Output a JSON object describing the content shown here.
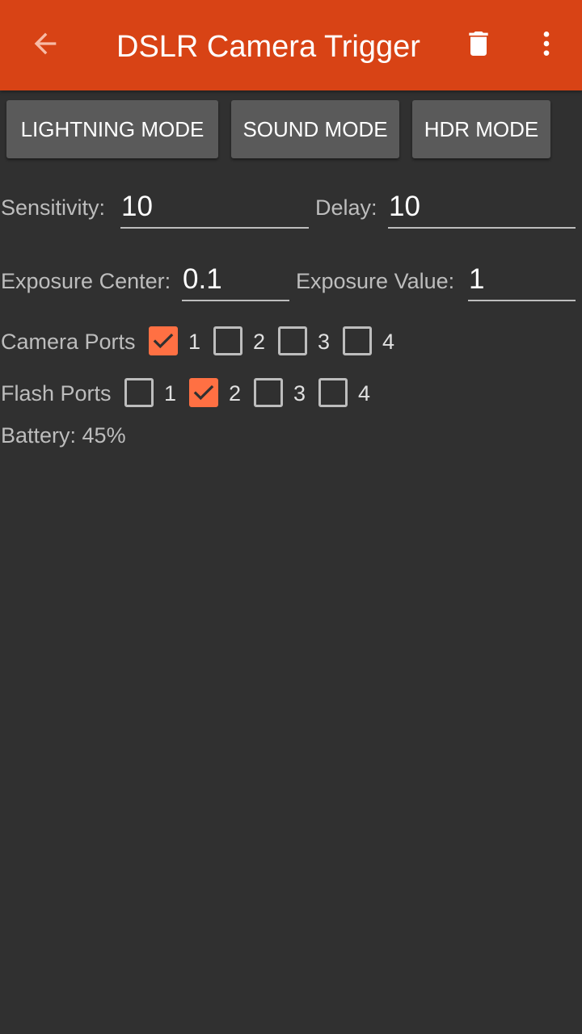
{
  "appbar": {
    "title": "DSLR Camera Trigger",
    "back_icon": "arrow-back-icon",
    "delete_icon": "trash-icon",
    "menu_icon": "more-vert-icon",
    "color": "#d84315"
  },
  "modes": {
    "lightning_label": "LIGHTNING MODE",
    "sound_label": "SOUND MODE",
    "hdr_label": "HDR MODE"
  },
  "fields": {
    "sensitivity": {
      "label": "Sensitivity:",
      "value": "10"
    },
    "delay": {
      "label": "Delay:",
      "value": "10"
    },
    "exposure_center": {
      "label": "Exposure Center:",
      "value": "0.1"
    },
    "exposure_value": {
      "label": "Exposure Value:",
      "value": "1"
    }
  },
  "camera_ports": {
    "label": "Camera Ports",
    "ports": [
      {
        "label": "1",
        "checked": true
      },
      {
        "label": "2",
        "checked": false
      },
      {
        "label": "3",
        "checked": false
      },
      {
        "label": "4",
        "checked": false
      }
    ]
  },
  "flash_ports": {
    "label": "Flash Ports",
    "ports": [
      {
        "label": "1",
        "checked": false
      },
      {
        "label": "2",
        "checked": true
      },
      {
        "label": "3",
        "checked": false
      },
      {
        "label": "4",
        "checked": false
      }
    ]
  },
  "battery": {
    "text": "Battery: 45%",
    "level_percent": 45
  },
  "colors": {
    "accent": "#ff7043",
    "background": "#303030",
    "button": "#5a5a5a"
  }
}
